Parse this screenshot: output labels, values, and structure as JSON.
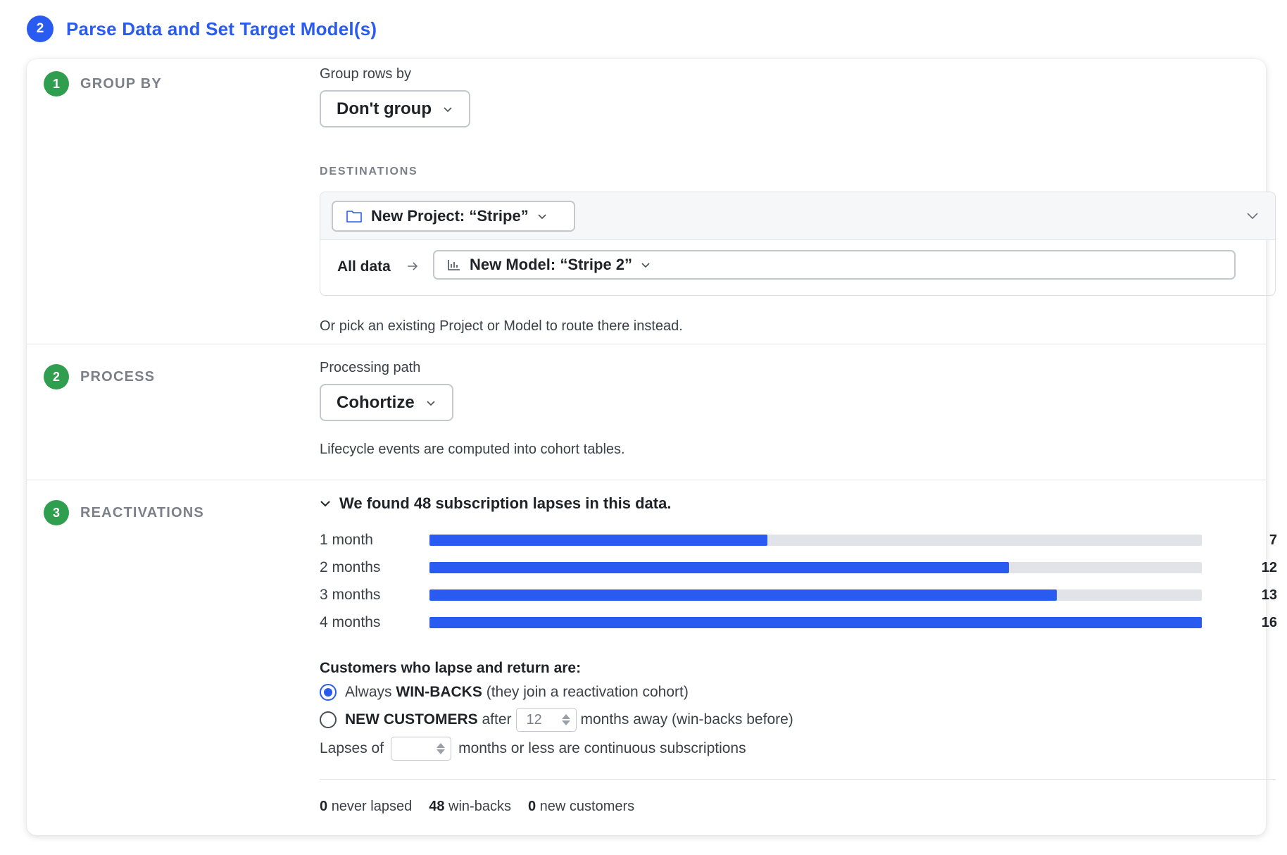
{
  "header": {
    "step_number": "2",
    "title": "Parse Data and Set Target Model(s)"
  },
  "group_by": {
    "step_number": "1",
    "label": "GROUP BY",
    "field_label": "Group rows by",
    "select_value": "Don't group",
    "destinations_label": "DESTINATIONS",
    "project_value": "New Project: “Stripe”",
    "all_data_label": "All data",
    "model_value": "New Model: “Stripe 2”",
    "helper": "Or pick an existing Project or Model to route there instead."
  },
  "process": {
    "step_number": "2",
    "label": "PROCESS",
    "field_label": "Processing path",
    "select_value": "Cohortize",
    "helper": "Lifecycle events are computed into cohort tables."
  },
  "reactivations": {
    "step_number": "3",
    "label": "REACTIVATIONS",
    "found_text": "We found 48 subscription lapses in this data.",
    "bars": [
      {
        "label": "1 month",
        "value": "7",
        "fraction": 0.4375
      },
      {
        "label": "2 months",
        "value": "12",
        "fraction": 0.75
      },
      {
        "label": "3 months",
        "value": "13",
        "fraction": 0.8125
      },
      {
        "label": "4 months",
        "value": "16",
        "fraction": 1.0
      }
    ],
    "customers_label": "Customers who lapse and return are:",
    "option_winback": {
      "prefix": "Always",
      "keyword": "WIN-BACKS",
      "suffix": "(they join a reactivation cohort)",
      "checked": true
    },
    "option_new": {
      "keyword": "NEW CUSTOMERS",
      "after": "after",
      "input_value": "12",
      "suffix": "months away (win-backs before)",
      "checked": false
    },
    "lapses_prefix": "Lapses of",
    "lapses_input_value": "",
    "lapses_suffix": "months or less are continuous subscriptions",
    "summary": {
      "never_lapsed_count": "0",
      "never_lapsed_label": "never lapsed",
      "winbacks_count": "48",
      "winbacks_label": "win-backs",
      "new_customers_count": "0",
      "new_customers_label": "new customers"
    }
  },
  "colors": {
    "accent": "#2a5bf0",
    "step_green": "#2f9e4f",
    "bar_track": "#e1e3e8"
  }
}
